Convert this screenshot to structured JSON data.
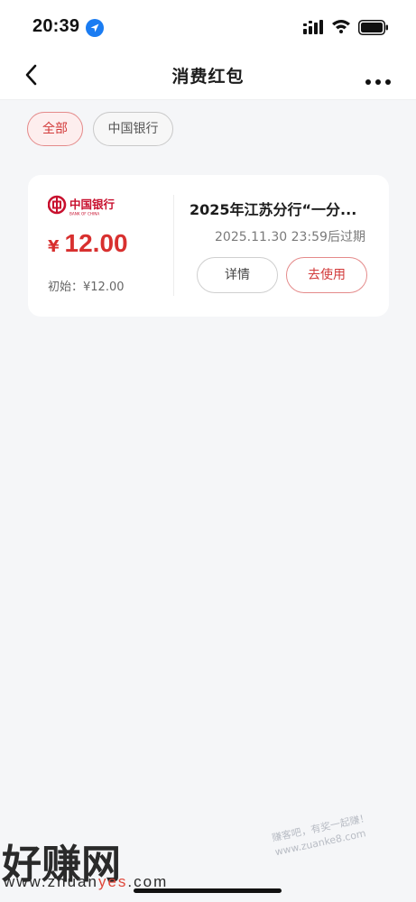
{
  "status_bar": {
    "time": "20:39",
    "icons": [
      "location-arrow-icon",
      "cellular-signal-icon",
      "wifi-icon",
      "battery-icon"
    ]
  },
  "nav": {
    "title": "消费红包",
    "back_icon": "chevron-left-icon",
    "more_icon": "more-dots-icon"
  },
  "filters": [
    {
      "label": "全部",
      "selected": true
    },
    {
      "label": "中国银行",
      "selected": false
    }
  ],
  "coupon": {
    "bank_logo": "bank-of-china-logo",
    "bank_logo_text": "中国银行",
    "bank_logo_en": "BANK OF CHINA",
    "currency_symbol": "¥",
    "amount": "12.00",
    "initial_label": "初始：¥12.00",
    "title": "2025年江苏分行“一分...",
    "expiry": "2025.11.30 23:59后过期",
    "detail_button": "详情",
    "use_button": "去使用"
  },
  "watermark": {
    "large_text": "好赚网",
    "url_prefix": "www.zhuan",
    "url_accent": "yes",
    "url_suffix": ".com",
    "small_line1": "赚客吧，有奖一起赚！",
    "small_line2": "www.zuanke8.com"
  },
  "colors": {
    "accent_red": "#d8302f",
    "chip_selected_bg": "#fdeeee",
    "page_bg": "#f5f6f8",
    "location_blue": "#1a7cf2"
  }
}
